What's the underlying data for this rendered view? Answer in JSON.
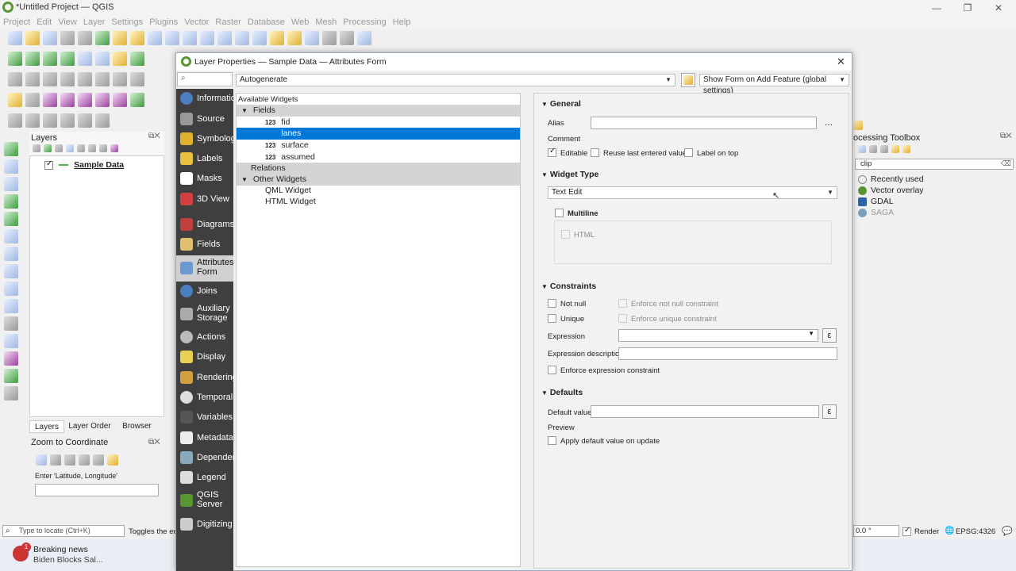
{
  "window": {
    "title": "*Untitled Project — QGIS"
  },
  "menubar": [
    "Project",
    "Edit",
    "View",
    "Layer",
    "Settings",
    "Plugins",
    "Vector",
    "Raster",
    "Database",
    "Web",
    "Mesh",
    "Processing",
    "Help"
  ],
  "layers_panel": {
    "title": "Layers",
    "layer_name": "Sample Data",
    "tabs": [
      "Layers",
      "Layer Order",
      "Browser"
    ]
  },
  "zoom_panel": {
    "title": "Zoom to Coordinate",
    "coord_label": "Enter 'Latitude, Longitude'"
  },
  "statusbar": {
    "locate_placeholder": "Type to locate (Ctrl+K)",
    "toggles_text": "Toggles the edi",
    "rotation": "0.0 °",
    "render_label": "Render",
    "crs": "EPSG:4326"
  },
  "taskbar": {
    "badge": "1",
    "news_title": "Breaking news",
    "news_text": "Biden Blocks Sal..."
  },
  "toolbox": {
    "title": "ocessing Toolbox",
    "search_value": "clip",
    "items": [
      "Recently used",
      "Vector overlay",
      "GDAL",
      "SAGA"
    ]
  },
  "dialog": {
    "title": "Layer Properties — Sample Data — Attributes Form",
    "layout_mode": "Autogenerate",
    "show_form": "Show Form on Add Feature (global settings)",
    "sidebar": [
      "Information",
      "Source",
      "Symbology",
      "Labels",
      "Masks",
      "3D View",
      "Diagrams",
      "Fields",
      "Attributes\nForm",
      "Joins",
      "Auxiliary\nStorage",
      "Actions",
      "Display",
      "Rendering",
      "Temporal",
      "Variables",
      "Metadata",
      "Dependencies",
      "Legend",
      "QGIS\nServer",
      "Digitizing"
    ],
    "available_widgets": "Available Widgets",
    "tree": {
      "fields": "Fields",
      "field_items": [
        {
          "type": "123",
          "name": "fid"
        },
        {
          "type": "123",
          "name": "lanes"
        },
        {
          "type": "123",
          "name": "surface"
        },
        {
          "type": "123",
          "name": "assumed"
        }
      ],
      "relations": "Relations",
      "other": "Other Widgets",
      "other_items": [
        "QML Widget",
        "HTML Widget"
      ]
    },
    "general": {
      "header": "General",
      "alias": "Alias",
      "alias_value": "",
      "comment": "Comment",
      "editable": "Editable",
      "reuse": "Reuse last entered value",
      "label_on_top": "Label on top",
      "more": "..."
    },
    "widget_type": {
      "header": "Widget Type",
      "value": "Text Edit",
      "multiline": "Multiline",
      "html": "HTML"
    },
    "constraints": {
      "header": "Constraints",
      "not_null": "Not null",
      "enforce_not_null": "Enforce not null constraint",
      "unique": "Unique",
      "enforce_unique": "Enforce unique constraint",
      "expression": "Expression",
      "expression_description": "Expression description",
      "enforce_expression": "Enforce expression constraint"
    },
    "defaults": {
      "header": "Defaults",
      "default_value": "Default value",
      "preview": "Preview",
      "apply_on_update": "Apply default value on update"
    }
  }
}
